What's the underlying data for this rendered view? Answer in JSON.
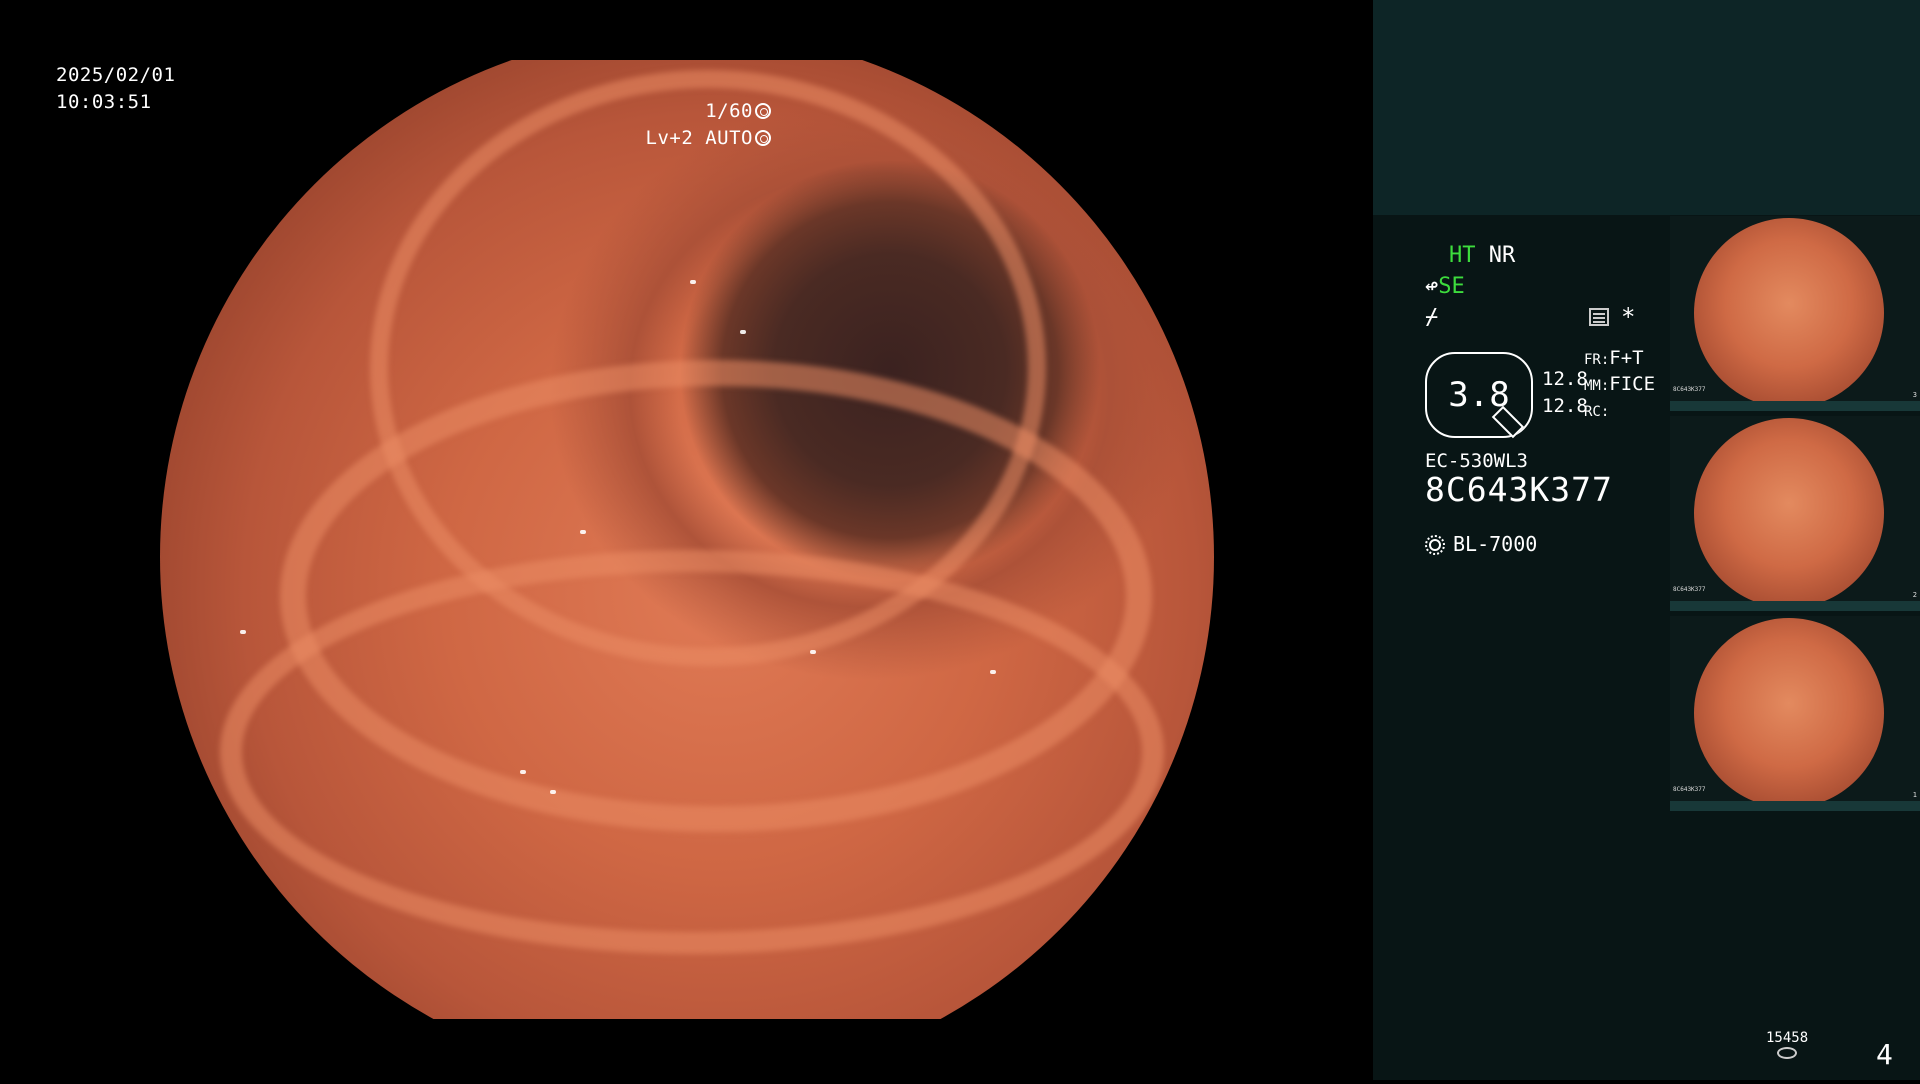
{
  "overlay": {
    "date": "2025/02/01",
    "time": "10:03:51",
    "shutter": "1/60",
    "brightness": "Lv+2 AUTO"
  },
  "status": {
    "ht": "HT",
    "nr": "NR",
    "se": "SE",
    "sharp_symbol": "⌿",
    "asterisk": "*"
  },
  "zoom": {
    "value": "3.8",
    "values_right": [
      "12.8",
      "12.8"
    ],
    "fr_label": "FR:",
    "fr_value": "F+T",
    "mm_label": "MM:",
    "mm_value": "FICE",
    "rc_label": "RC:"
  },
  "scope": {
    "model": "EC-530WL3",
    "serial": "8C643K377",
    "light_source": "BL-7000"
  },
  "thumbnails": [
    {
      "number": "3",
      "serial": "8C643K377"
    },
    {
      "number": "2",
      "serial": "8C643K377"
    },
    {
      "number": "1",
      "serial": "8C643K377"
    }
  ],
  "storage": {
    "count": "15458"
  },
  "page_number": "4",
  "colors": {
    "accent_green": "#3ddc3d",
    "panel_bg": "#081515",
    "panel_top": "#0d2526"
  },
  "icons": [
    "shutter-icon",
    "auto-icon",
    "card-icon",
    "sun-icon",
    "storage-icon",
    "zoom-badge-icon"
  ]
}
